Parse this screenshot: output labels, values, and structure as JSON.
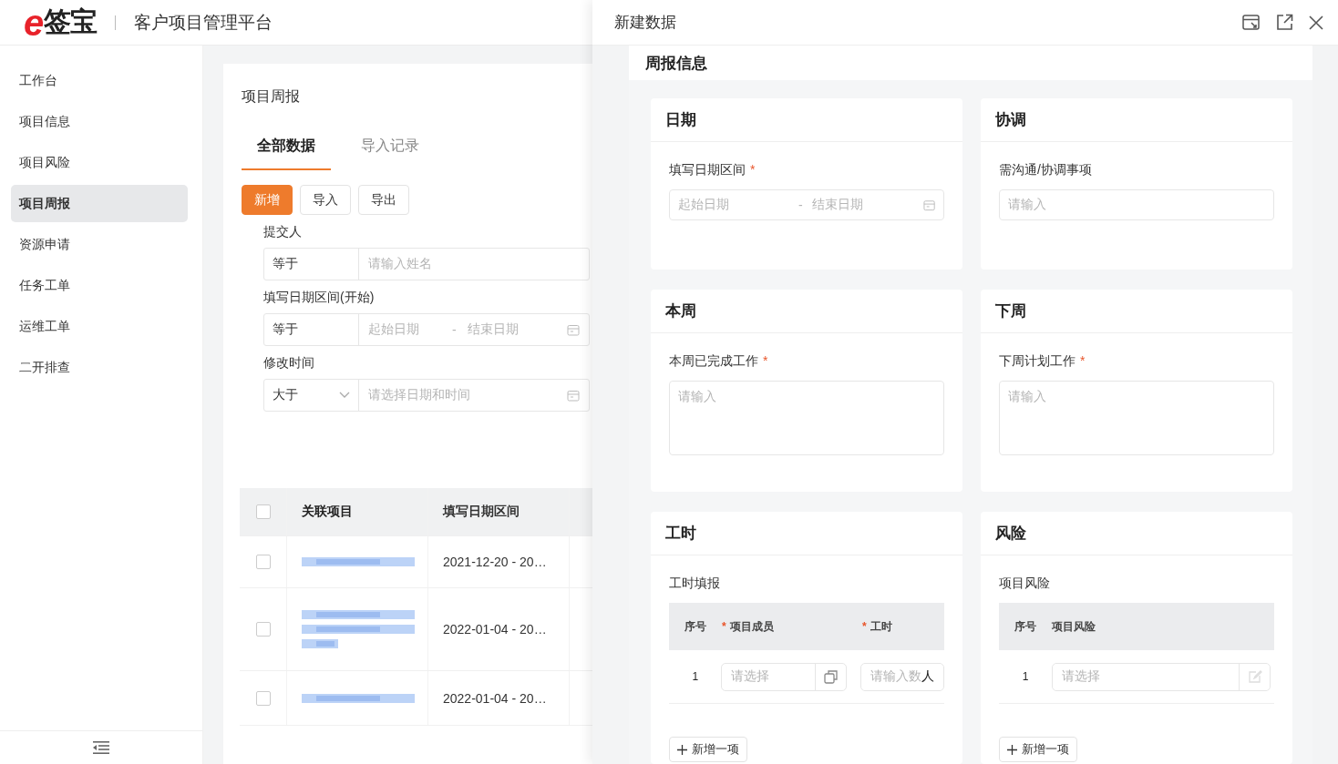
{
  "logo": {
    "mark": "e",
    "text": "签宝"
  },
  "app_title": "客户项目管理平台",
  "sidebar": {
    "items": [
      {
        "label": "工作台",
        "selected": false
      },
      {
        "label": "项目信息",
        "selected": false
      },
      {
        "label": "项目风险",
        "selected": false
      },
      {
        "label": "项目周报",
        "selected": true
      },
      {
        "label": "资源申请",
        "selected": false
      },
      {
        "label": "任务工单",
        "selected": false
      },
      {
        "label": "运维工单",
        "selected": false
      },
      {
        "label": "二开排查",
        "selected": false
      }
    ]
  },
  "page": {
    "title": "项目周报",
    "tabs": [
      {
        "label": "全部数据",
        "selected": true
      },
      {
        "label": "导入记录",
        "selected": false
      }
    ],
    "buttons": [
      {
        "label": "新增",
        "kind": "primary"
      },
      {
        "label": "导入",
        "kind": "default"
      },
      {
        "label": "导出",
        "kind": "default"
      }
    ],
    "filters": [
      {
        "label": "提交人",
        "operator": "等于",
        "dropdown": false,
        "kind": "text",
        "placeholder": "请输入姓名"
      },
      {
        "label": "填写日期区间(开始)",
        "operator": "等于",
        "dropdown": false,
        "kind": "date-range",
        "start": "起始日期",
        "separator": "-",
        "end": "结束日期"
      },
      {
        "label": "修改时间",
        "operator": "大于",
        "dropdown": true,
        "kind": "datetime",
        "placeholder": "请选择日期和时间"
      }
    ],
    "table": {
      "header_checked": false,
      "columns": [
        "关联项目",
        "填写日期区间"
      ],
      "rows": [
        {
          "checked": false,
          "kind": "short",
          "date": "2021-12-20 - 20…"
        },
        {
          "checked": false,
          "kind": "tall",
          "date": "2022-01-04 - 20…"
        },
        {
          "checked": false,
          "kind": "short",
          "date": "2022-01-04 - 20…"
        }
      ]
    }
  },
  "drawer": {
    "title": "新建数据",
    "section": "周报信息",
    "cards": [
      {
        "title": "日期",
        "label": "填写日期区间",
        "required_mark": "*",
        "kind": "date-range",
        "start": "起始日期",
        "separator": "-",
        "end": "结束日期"
      },
      {
        "title": "协调",
        "label": "需沟通/协调事项",
        "kind": "input",
        "placeholder": "请输入"
      },
      {
        "title": "本周",
        "label": "本周已完成工作",
        "required_mark": "*",
        "kind": "textarea",
        "placeholder": "请输入"
      },
      {
        "title": "下周",
        "label": "下周计划工作",
        "required_mark": "*",
        "kind": "textarea",
        "placeholder": "请输入"
      },
      {
        "title": "工时",
        "label": "工时填报",
        "kind": "table",
        "columns": [
          {
            "label": "序号"
          },
          {
            "label": "项目成员",
            "required_mark": "*"
          },
          {
            "label": "工时",
            "required_mark": "*"
          }
        ],
        "rows": [
          {
            "cells": [
              {
                "kind": "index",
                "text": "1"
              },
              {
                "kind": "picker",
                "placeholder": "请选择"
              },
              {
                "kind": "number",
                "placeholder": "请输入数",
                "unit": "人"
              }
            ]
          }
        ],
        "add_button": "新增一项"
      },
      {
        "title": "风险",
        "label": "项目风险",
        "kind": "table",
        "columns": [
          {
            "label": "序号"
          },
          {
            "label": "项目风险"
          }
        ],
        "rows": [
          {
            "cells": [
              {
                "kind": "index",
                "text": "1"
              },
              {
                "kind": "editor",
                "placeholder": "请选择"
              }
            ]
          }
        ],
        "add_button": "新增一项"
      }
    ]
  }
}
